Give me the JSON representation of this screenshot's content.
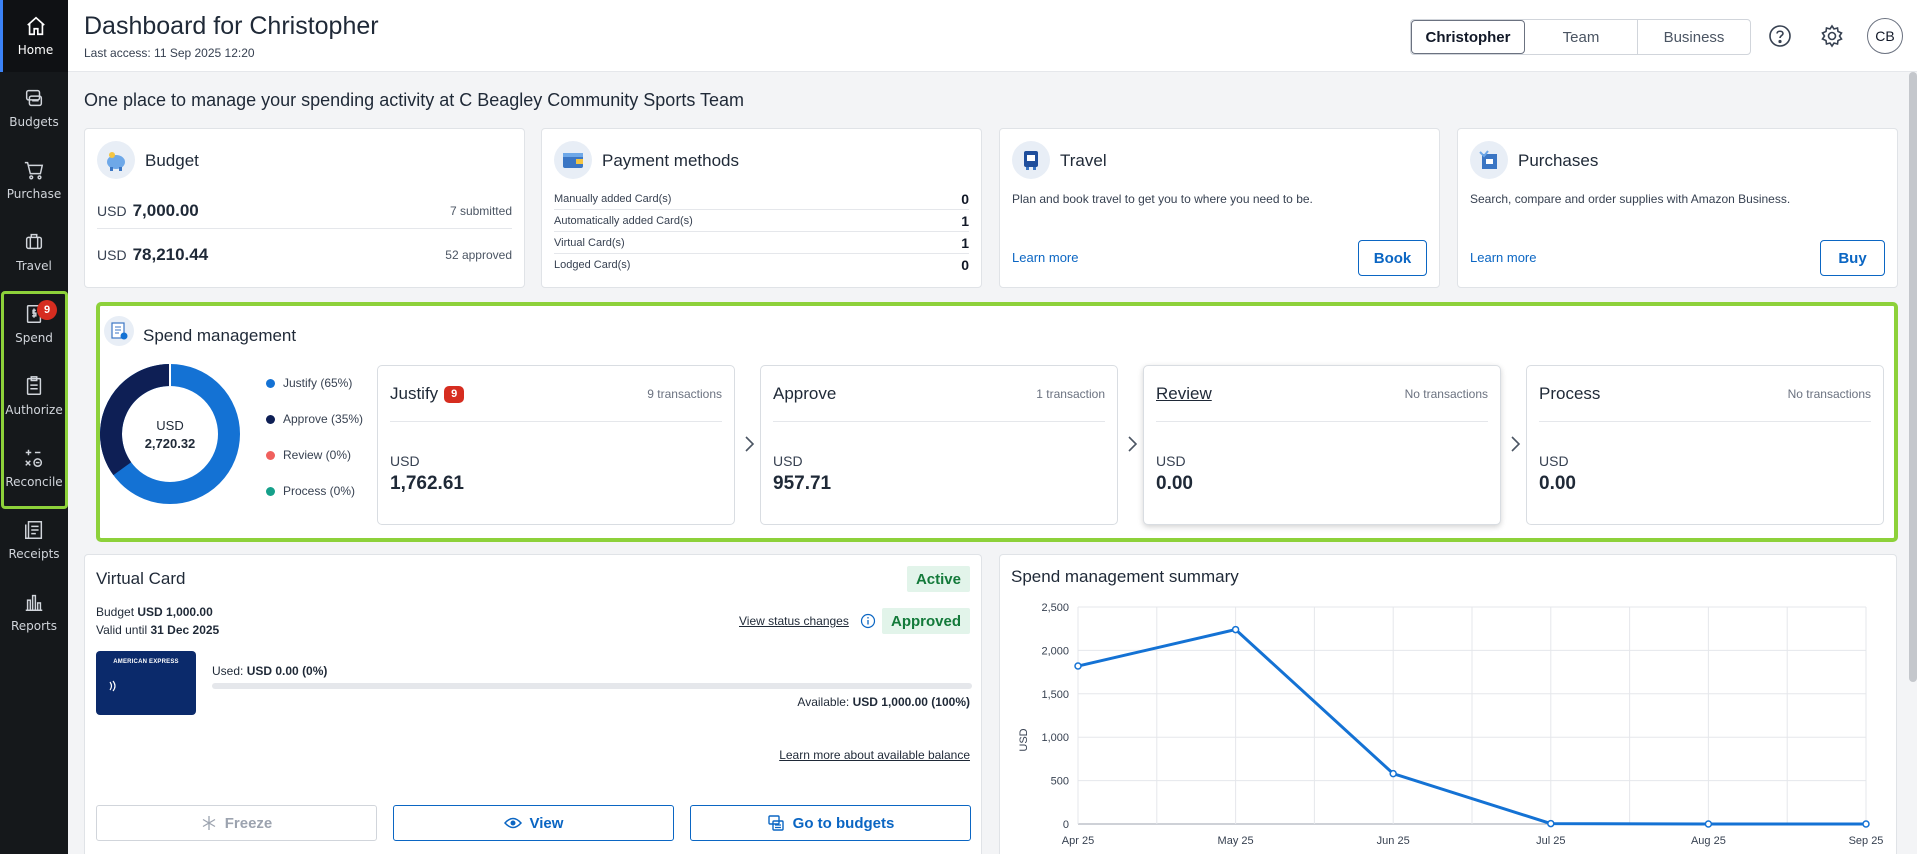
{
  "sidebar": {
    "items": [
      {
        "label": "Home",
        "icon": "home-icon"
      },
      {
        "label": "Budgets",
        "icon": "piggy-bank-icon"
      },
      {
        "label": "Purchase",
        "icon": "cart-icon"
      },
      {
        "label": "Travel",
        "icon": "suitcase-icon"
      },
      {
        "label": "Spend",
        "icon": "receipt-dollar-icon",
        "badge": "9"
      },
      {
        "label": "Authorize",
        "icon": "clipboard-check-icon"
      },
      {
        "label": "Reconcile",
        "icon": "reconcile-icon"
      },
      {
        "label": "Receipts",
        "icon": "receipts-icon"
      },
      {
        "label": "Reports",
        "icon": "bar-chart-icon"
      }
    ]
  },
  "header": {
    "title": "Dashboard for Christopher",
    "last_access": "Last access: 11 Sep 2025 12:20",
    "views": [
      "Christopher",
      "Team",
      "Business"
    ],
    "selected_view": "Christopher",
    "avatar": "CB"
  },
  "subtitle": "One place to manage your spending activity at C Beagley Community Sports Team",
  "budget_card": {
    "title": "Budget",
    "rows": [
      {
        "currency": "USD",
        "amount": "7,000.00",
        "note": "7 submitted"
      },
      {
        "currency": "USD",
        "amount": "78,210.44",
        "note": "52 approved"
      }
    ]
  },
  "payment_card": {
    "title": "Payment methods",
    "rows": [
      {
        "label": "Manually added Card(s)",
        "value": "0"
      },
      {
        "label": "Automatically added Card(s)",
        "value": "1"
      },
      {
        "label": "Virtual Card(s)",
        "value": "1"
      },
      {
        "label": "Lodged Card(s)",
        "value": "0"
      }
    ]
  },
  "travel_card": {
    "title": "Travel",
    "description": "Plan and book travel to get you to where you need to be.",
    "learn_more": "Learn more",
    "button": "Book"
  },
  "purchases_card": {
    "title": "Purchases",
    "description": "Search, compare and order supplies with Amazon Business.",
    "learn_more": "Learn more",
    "button": "Buy"
  },
  "spend": {
    "title": "Spend management",
    "total_currency": "USD",
    "total_amount": "2,720.32",
    "legend": [
      {
        "label": "Justify (65%)",
        "color": "#1472d4",
        "percent": 65
      },
      {
        "label": "Approve (35%)",
        "color": "#0e1f55",
        "percent": 35
      },
      {
        "label": "Review (0%)",
        "color": "#f0605d",
        "percent": 0
      },
      {
        "label": "Process (0%)",
        "color": "#15a08a",
        "percent": 0
      }
    ],
    "stages": [
      {
        "name": "Justify",
        "badge": "9",
        "count": "9 transactions",
        "currency": "USD",
        "amount": "1,762.61"
      },
      {
        "name": "Approve",
        "count": "1 transaction",
        "currency": "USD",
        "amount": "957.71"
      },
      {
        "name": "Review",
        "count": "No transactions",
        "currency": "USD",
        "amount": "0.00"
      },
      {
        "name": "Process",
        "count": "No transactions",
        "currency": "USD",
        "amount": "0.00"
      }
    ]
  },
  "virtual_card": {
    "title": "Virtual Card",
    "status": "Active",
    "approval": "Approved",
    "budget_label": "Budget",
    "budget_value": "USD 1,000.00",
    "valid_label": "Valid until",
    "valid_value": "31 Dec 2025",
    "view_status": "View status changes",
    "card_brand": "AMERICAN EXPRESS",
    "used_label": "Used:",
    "used_value": "USD 0.00 (0%)",
    "used_fraction": 0,
    "available_label": "Available:",
    "available_value": "USD 1,000.00 (100%)",
    "learn_more": "Learn more about available balance",
    "buttons": {
      "freeze": "Freeze",
      "view": "View",
      "budgets": "Go to budgets"
    }
  },
  "summary": {
    "title": "Spend management summary"
  },
  "chart_data": {
    "type": "line",
    "title": "Spend management summary",
    "xlabel": "",
    "ylabel": "USD",
    "categories": [
      "Apr 25",
      "May 25",
      "Jun 25",
      "Jul 25",
      "Aug 25",
      "Sep 25"
    ],
    "x": [
      0,
      0.5,
      1,
      1.5,
      2,
      2.5,
      3,
      3.5,
      4,
      4.5,
      5
    ],
    "points": [
      {
        "x": 0,
        "y": 1820
      },
      {
        "x": 1,
        "y": 2240
      },
      {
        "x": 2,
        "y": 580
      },
      {
        "x": 3,
        "y": 5
      },
      {
        "x": 4,
        "y": 0
      },
      {
        "x": 5,
        "y": 0
      }
    ],
    "yticks": [
      "0",
      "500",
      "1,000",
      "1,500",
      "2,000",
      "2,500"
    ],
    "ylim": [
      0,
      2500
    ],
    "grid": true,
    "color": "#1472d4"
  }
}
